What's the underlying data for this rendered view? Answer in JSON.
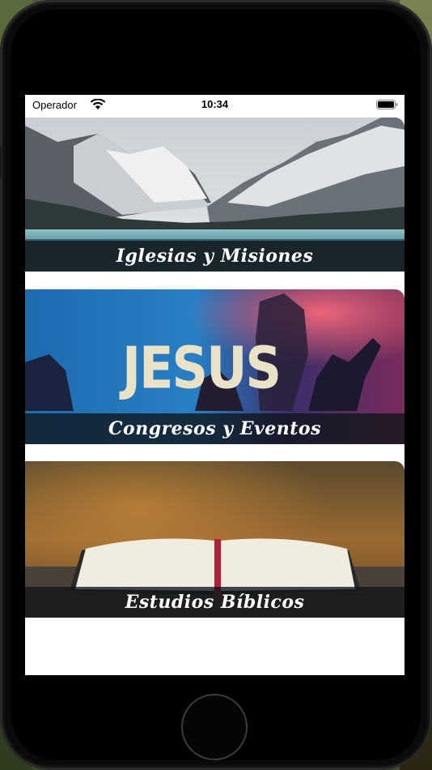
{
  "status_bar": {
    "carrier": "Operador",
    "time": "10:34"
  },
  "menu_items": [
    {
      "label": "Iglesias y Misiones"
    },
    {
      "label": "Congresos y Eventos",
      "image_text": "JESUS"
    },
    {
      "label": "Estudios Bíblicos"
    }
  ]
}
